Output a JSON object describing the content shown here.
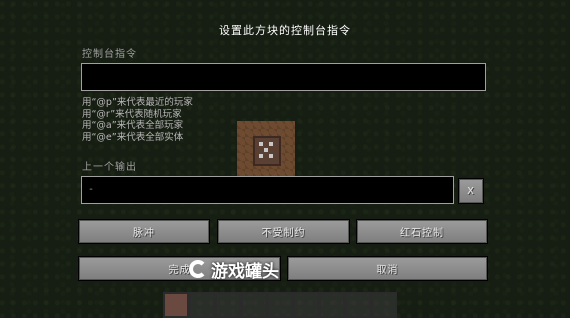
{
  "window": {
    "title": "设置此方块的控制台指令"
  },
  "command": {
    "label": "控制台指令",
    "value": ""
  },
  "help": {
    "lines": [
      "用“@p”来代表最近的玩家",
      "用“@r”来代表随机玩家",
      "用“@a”来代表全部玩家",
      "用“@e”来代表全部实体"
    ]
  },
  "previous_output": {
    "label": "上一个输出",
    "value": "-",
    "toggle_label": "X"
  },
  "mode_buttons": {
    "impulse": "脉冲",
    "unconditional": "不受制约",
    "redstone": "红石控制"
  },
  "actions": {
    "done": "完成",
    "cancel": "取消"
  },
  "watermark": {
    "text": "游戏罐头"
  },
  "hotbar": {
    "slot_count": 9,
    "selected_index": 0
  }
}
